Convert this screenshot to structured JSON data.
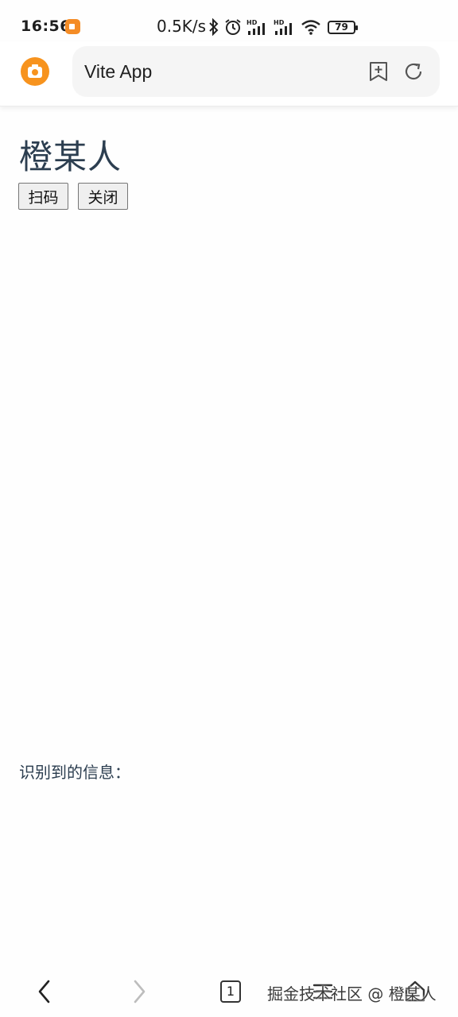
{
  "status_bar": {
    "time": "16:56",
    "net_speed": "0.5K/s",
    "battery": "79",
    "icons": [
      "screen-record-icon",
      "bluetooth-icon",
      "alarm-icon",
      "hd-signal-icon",
      "hd-signal-icon",
      "wifi-icon",
      "battery-icon"
    ]
  },
  "browser": {
    "address_text": "Vite App",
    "icons": [
      "camera-logo-icon",
      "bookmark-add-icon",
      "refresh-icon"
    ],
    "accent_color": "#f7931e"
  },
  "page": {
    "title": "橙某人",
    "scan_button": "扫码",
    "close_button": "关闭",
    "result_label": "识别到的信息：",
    "result_value": ""
  },
  "bottom_nav": {
    "tab_count": "1",
    "icons": [
      "back-icon",
      "forward-icon",
      "tabs-icon",
      "menu-icon",
      "home-icon"
    ]
  },
  "watermark": "掘金技术社区 @ 橙某人"
}
